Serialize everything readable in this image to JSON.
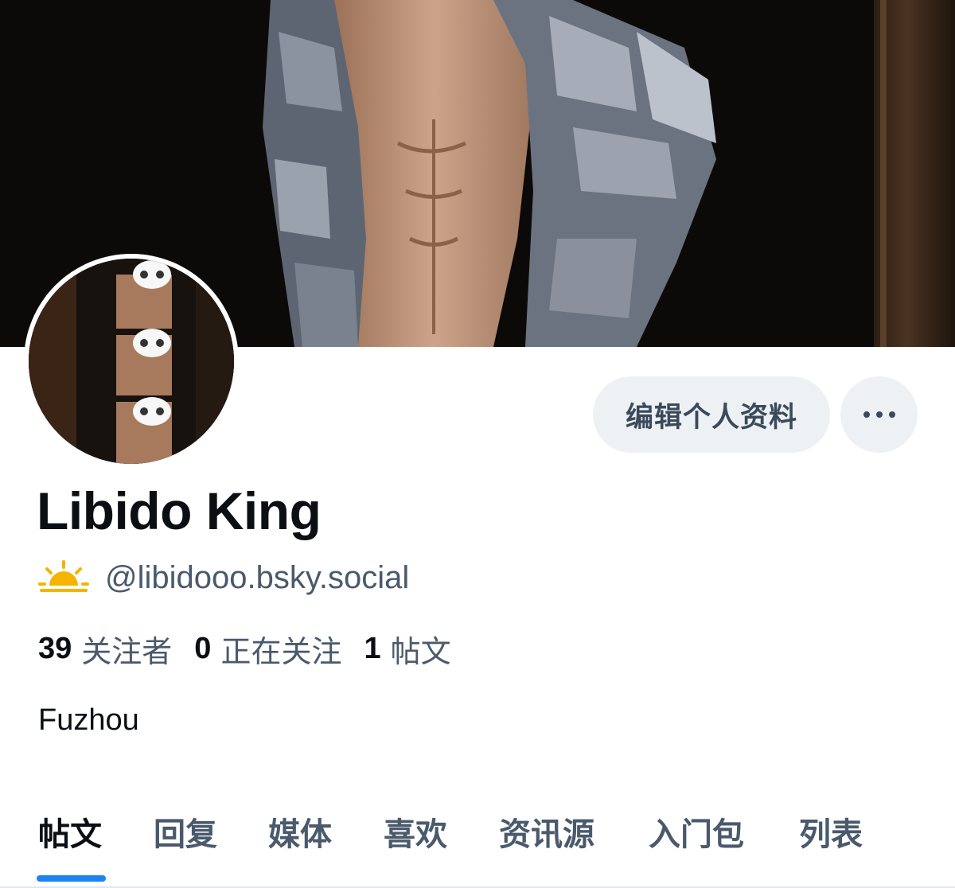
{
  "banner": {
    "alt": "banner-photo"
  },
  "avatar": {
    "alt": "avatar-photo"
  },
  "actions": {
    "edit_profile_label": "编辑个人资料",
    "more_icon": "ellipsis-icon"
  },
  "profile": {
    "display_name": "Libido King",
    "status_icon": "sun-icon",
    "handle": "@libidooo.bsky.social",
    "bio": "Fuzhou"
  },
  "stats": [
    {
      "count": "39",
      "label": "关注者"
    },
    {
      "count": "0",
      "label": "正在关注"
    },
    {
      "count": "1",
      "label": "帖文"
    }
  ],
  "tabs": [
    {
      "label": "帖文",
      "active": true
    },
    {
      "label": "回复",
      "active": false
    },
    {
      "label": "媒体",
      "active": false
    },
    {
      "label": "喜欢",
      "active": false
    },
    {
      "label": "资讯源",
      "active": false
    },
    {
      "label": "入门包",
      "active": false
    },
    {
      "label": "列表",
      "active": false
    }
  ],
  "colors": {
    "accent": "#1d83f0",
    "button_bg": "#eef1f4",
    "muted_text": "#4a5a6c",
    "sun": "#f5b400"
  }
}
